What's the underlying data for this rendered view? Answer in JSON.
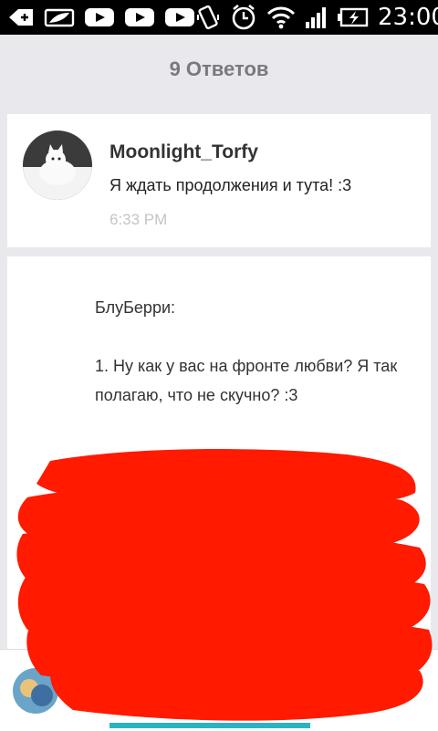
{
  "status_bar": {
    "time": "23:00",
    "icons": [
      "add-icon",
      "photo-icon",
      "youtube-icon",
      "youtube-icon",
      "youtube-icon",
      "vibrate-icon",
      "alarm-icon",
      "wifi-icon",
      "signal-icon",
      "battery-charging-icon"
    ]
  },
  "header": {
    "title": "9 Ответов"
  },
  "reply": {
    "username": "Moonlight_Torfy",
    "text": "Я ждать продолжения и тута! :3",
    "timestamp": "6:33 PM"
  },
  "post": {
    "text": "БлуБерри:\n\n1. Ну как у вас на фронте любви? Я так полагаю, что не скучно? :3"
  },
  "colors": {
    "background": "#e9e9ed",
    "redaction": "#ff1a00",
    "accent": "#2bb3c4"
  }
}
